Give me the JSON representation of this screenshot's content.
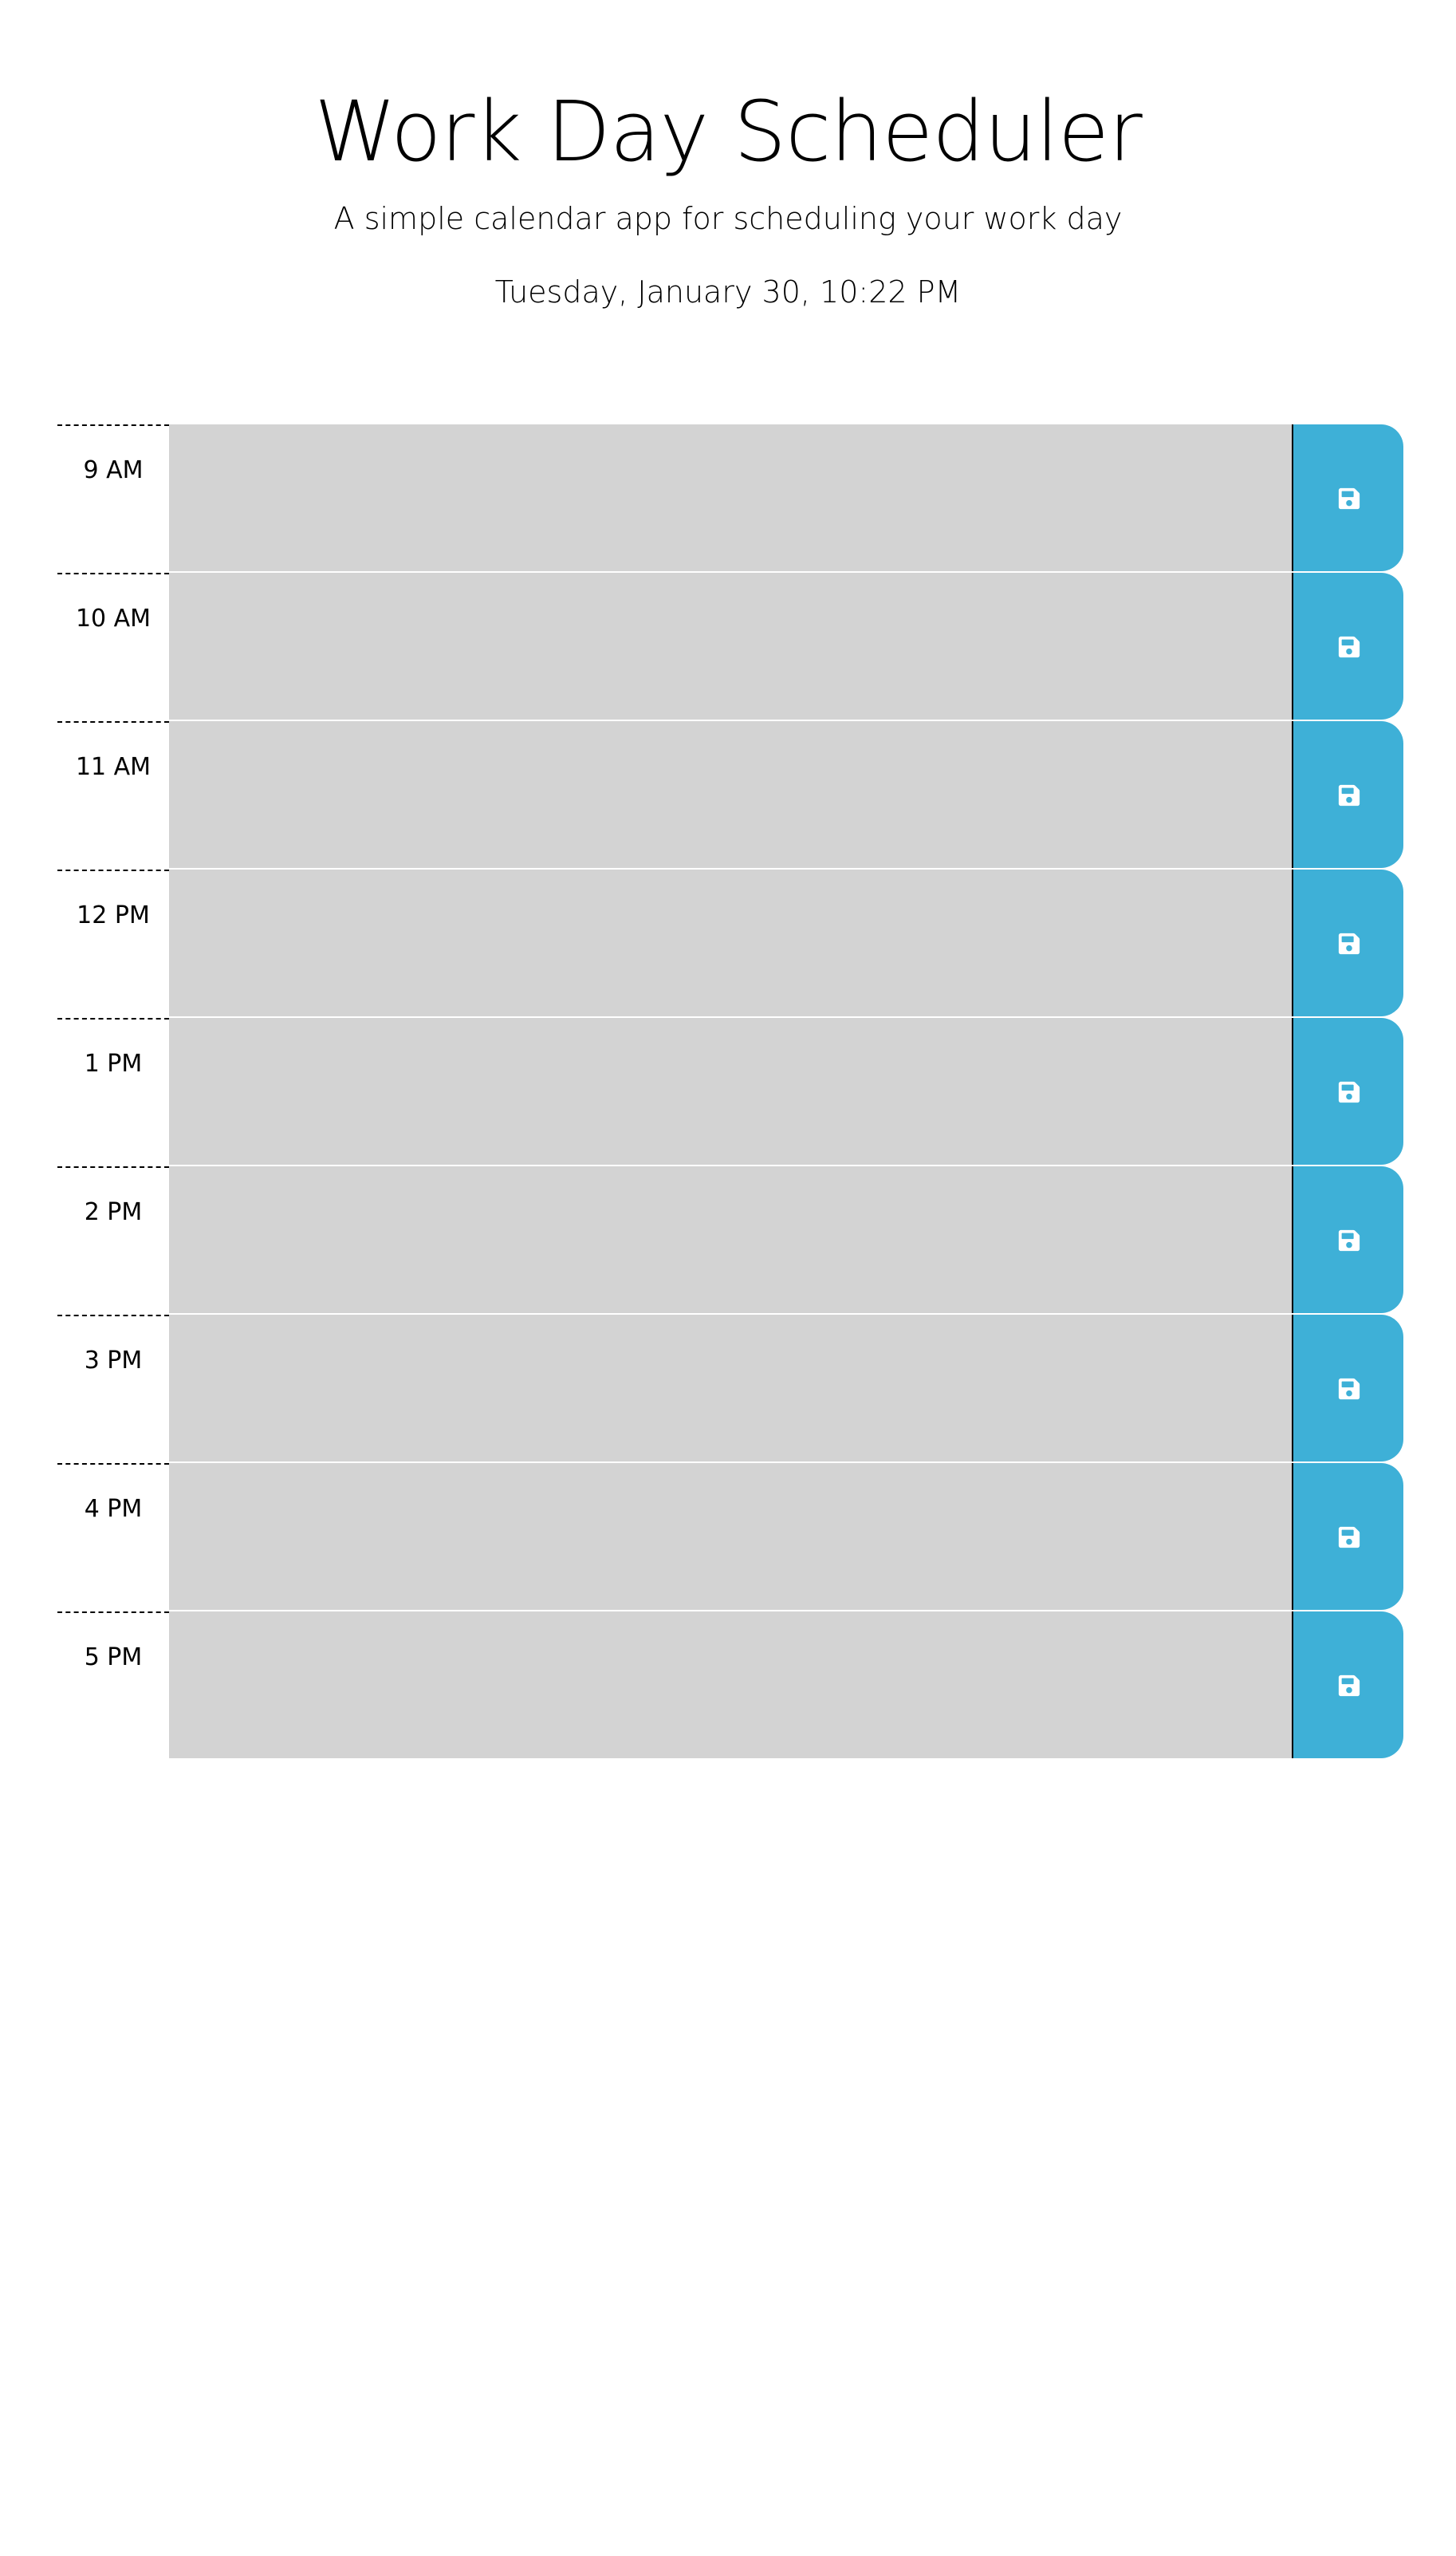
{
  "header": {
    "title": "Work Day Scheduler",
    "lead": "A simple calendar app for scheduling your work day",
    "current_day": "Tuesday, January 30, 10:22 PM"
  },
  "colors": {
    "past": "#d3d3d3",
    "save_button": "#3eb0d7",
    "save_icon": "#ffffff"
  },
  "save_icon_name": "save-icon",
  "time_blocks": [
    {
      "hour": "9 AM",
      "text": "",
      "state": "past"
    },
    {
      "hour": "10 AM",
      "text": "",
      "state": "past"
    },
    {
      "hour": "11 AM",
      "text": "",
      "state": "past"
    },
    {
      "hour": "12 PM",
      "text": "",
      "state": "past"
    },
    {
      "hour": "1 PM",
      "text": "",
      "state": "past"
    },
    {
      "hour": "2 PM",
      "text": "",
      "state": "past"
    },
    {
      "hour": "3 PM",
      "text": "",
      "state": "past"
    },
    {
      "hour": "4 PM",
      "text": "",
      "state": "past"
    },
    {
      "hour": "5 PM",
      "text": "",
      "state": "past"
    }
  ]
}
